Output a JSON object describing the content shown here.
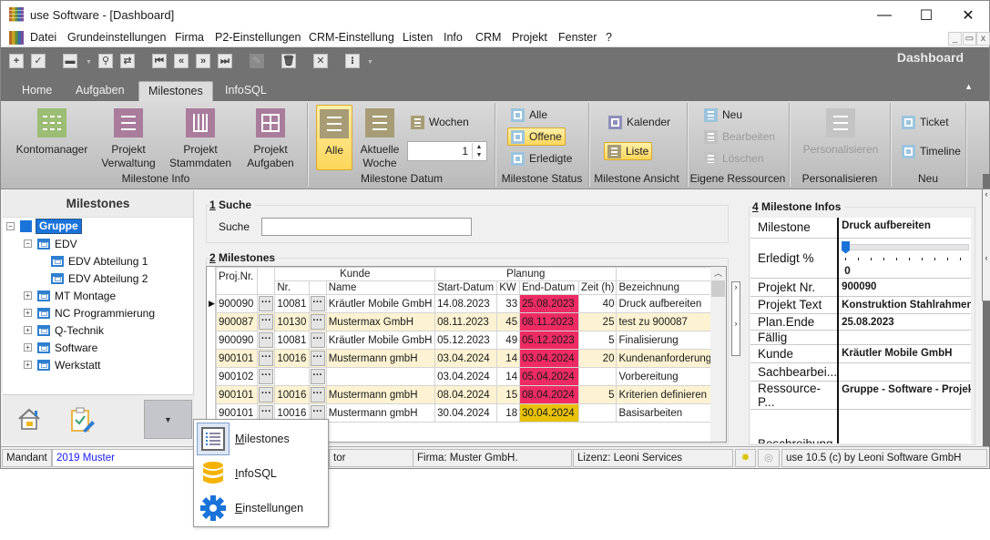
{
  "window": {
    "title": "use Software - [Dashboard]",
    "controls": {
      "minimize": "—",
      "maximize": "☐",
      "close": "✕"
    }
  },
  "menu": {
    "items": [
      "Datei",
      "Grundeinstellungen",
      "Firma",
      "P2-Einstellungen",
      "CRM-Einstellung",
      "Listen",
      "Info",
      "CRM",
      "Projekt",
      "Fenster",
      "?"
    ],
    "mdi_controls": [
      "_",
      "▭",
      "x"
    ]
  },
  "toolbar": {
    "icons": [
      "add-icon",
      "check-icon",
      "print-icon",
      "search-icon",
      "refresh-icon",
      "first-icon",
      "previous-icon",
      "next-icon",
      "last-icon",
      "edit-icon",
      "delete-icon",
      "cancel-icon",
      "grid-icon"
    ],
    "dashboard_label": "Dashboard"
  },
  "tabs": [
    {
      "label": "Home",
      "active": false
    },
    {
      "label": "Aufgaben",
      "active": false
    },
    {
      "label": "Milestones",
      "active": true
    },
    {
      "label": "InfoSQL",
      "active": false
    }
  ],
  "ribbon": {
    "milestone_info": {
      "label": "Milestone Info",
      "buttons": [
        {
          "label1": "Kontomanager",
          "label2": "",
          "color": "#9cbd74"
        },
        {
          "label1": "Projekt",
          "label2": "Verwaltung",
          "color": "#a97c9c"
        },
        {
          "label1": "Projekt",
          "label2": "Stammdaten",
          "color": "#a97c9c"
        },
        {
          "label1": "Projekt",
          "label2": "Aufgaben",
          "color": "#a97c9c"
        }
      ]
    },
    "milestone_datum": {
      "label": "Milestone Datum",
      "alle": "Alle",
      "aktuelle_woche1": "Aktuelle",
      "aktuelle_woche2": "Woche",
      "wochen": "Wochen",
      "wochen_value": "1",
      "color": "#a79c75"
    },
    "milestone_status": {
      "label": "Milestone Status",
      "items": [
        {
          "label": "Alle",
          "selected": false
        },
        {
          "label": "Offene",
          "selected": true
        },
        {
          "label": "Erledigte",
          "selected": false
        }
      ],
      "color": "#9cc4dd"
    },
    "milestone_ansicht": {
      "label": "Milestone Ansicht",
      "kalender": "Kalender",
      "liste": "Liste"
    },
    "eigene_ressourcen": {
      "label": "Eigene Ressourcen",
      "neu": "Neu",
      "bearbeiten": "Bearbeiten",
      "loeschen": "Löschen"
    },
    "personalisieren": {
      "label": "Personalisieren",
      "button": "Personalisieren"
    },
    "neu": {
      "label": "Neu",
      "ticket": "Ticket",
      "timeline": "Timeline"
    }
  },
  "sidebar": {
    "title": "Milestones",
    "tree": [
      {
        "label": "Gruppe",
        "level": 0,
        "expander": "−",
        "selected": true
      },
      {
        "label": "EDV",
        "level": 1,
        "expander": "−"
      },
      {
        "label": "EDV Abteilung 1",
        "level": 2,
        "expander": ""
      },
      {
        "label": "EDV Abteilung 2",
        "level": 2,
        "expander": ""
      },
      {
        "label": "MT Montage",
        "level": 1,
        "expander": "+"
      },
      {
        "label": "NC Programmierung",
        "level": 1,
        "expander": "+"
      },
      {
        "label": "Q-Technik",
        "level": 1,
        "expander": "+"
      },
      {
        "label": "Software",
        "level": 1,
        "expander": "+"
      },
      {
        "label": "Werkstatt",
        "level": 1,
        "expander": "+"
      }
    ],
    "bottom_icons": [
      "home-icon",
      "clipboard-edit-icon"
    ],
    "dropdown_arrow": "▼"
  },
  "search": {
    "section_num": "1",
    "section_title": " Suche",
    "label": "Suche",
    "value": ""
  },
  "milestones": {
    "section_num": "2",
    "section_title": " Milestones",
    "group_headers": {
      "kunde": "Kunde",
      "planung": "Planung"
    },
    "columns": {
      "proj": "Proj.Nr.",
      "nr": "Nr.",
      "name": "Name",
      "start": "Start-Datum",
      "kw": "KW",
      "end": "End-Datum",
      "zeit": "Zeit (h)",
      "bez": "Bezeichnung"
    },
    "rows": [
      {
        "proj": "900090",
        "nr": "10081",
        "name": "Kräutler Mobile GmbH",
        "start": "14.08.2023",
        "kw": "33",
        "end": "25.08.2023",
        "end_status": "red",
        "zeit": "40",
        "bez": "Druck aufbereiten",
        "current": true
      },
      {
        "proj": "900087",
        "nr": "10130",
        "name": "Mustermax GmbH",
        "start": "08.11.2023",
        "kw": "45",
        "end": "08.11.2023",
        "end_status": "red",
        "zeit": "25",
        "bez": "test zu 900087"
      },
      {
        "proj": "900090",
        "nr": "10081",
        "name": "Kräutler Mobile GmbH",
        "start": "05.12.2023",
        "kw": "49",
        "end": "05.12.2023",
        "end_status": "red",
        "zeit": "5",
        "bez": "Finalisierung"
      },
      {
        "proj": "900101",
        "nr": "10016",
        "name": "Mustermann gmbH",
        "start": "03.04.2024",
        "kw": "14",
        "end": "03.04.2024",
        "end_status": "red",
        "zeit": "20",
        "bez": "Kundenanforderungen"
      },
      {
        "proj": "900102",
        "nr": "",
        "name": "",
        "start": "03.04.2024",
        "kw": "14",
        "end": "05.04.2024",
        "end_status": "red",
        "zeit": "",
        "bez": "Vorbereitung"
      },
      {
        "proj": "900101",
        "nr": "10016",
        "name": "Mustermann gmbH",
        "start": "08.04.2024",
        "kw": "15",
        "end": "08.04.2024",
        "end_status": "red",
        "zeit": "5",
        "bez": "Kriterien definieren"
      },
      {
        "proj": "900101",
        "nr": "10016",
        "name": "Mustermann gmbH",
        "start": "30.04.2024",
        "kw": "18",
        "end": "30.04.2024",
        "end_status": "yellow",
        "zeit": "",
        "bez": "Basisarbeiten"
      }
    ],
    "dots_label": "···",
    "status_colors": {
      "red": "#ef2b64",
      "yellow": "#e8c10a",
      "alt_row": "#fdf3d2"
    }
  },
  "milestone_infos": {
    "section_num": "4",
    "section_title": " Milestone Infos",
    "fields": [
      {
        "key": "Milestone",
        "value": "Druck aufbereiten"
      },
      {
        "key": "Erledigt %",
        "value": "0",
        "progress_percent": 0
      },
      {
        "key": "Projekt Nr.",
        "value": "900090"
      },
      {
        "key": "Projekt Text",
        "value": "Konstruktion Stahlrahmen"
      },
      {
        "key": "Plan.Ende",
        "value": "25.08.2023"
      },
      {
        "key": "Fällig",
        "value": ""
      },
      {
        "key": "Kunde",
        "value": "Kräutler Mobile GmbH"
      },
      {
        "key": "Sachbearbei...",
        "value": ""
      },
      {
        "key": "Ressource-P...",
        "value": "Gruppe - Software - Projekt"
      },
      {
        "key": "Beschreibung",
        "value": ""
      }
    ]
  },
  "statusbar": {
    "mandant_label": "Mandant",
    "mandant_value": "2019 Muster",
    "user_partial": "tor",
    "firma": "Firma: Muster GmbH.",
    "lizenz": "Lizenz: Leoni Services",
    "version": "use 10.5 (c) by Leoni Software GmbH"
  },
  "popup_menu": {
    "items": [
      {
        "label": "Milestones",
        "accel": "M",
        "icon": "list-icon",
        "selected": true
      },
      {
        "label": "InfoSQL",
        "accel": "I",
        "icon": "database-icon",
        "selected": false
      },
      {
        "label": "Einstellungen",
        "accel": "E",
        "icon": "gear-icon",
        "selected": false
      }
    ]
  }
}
